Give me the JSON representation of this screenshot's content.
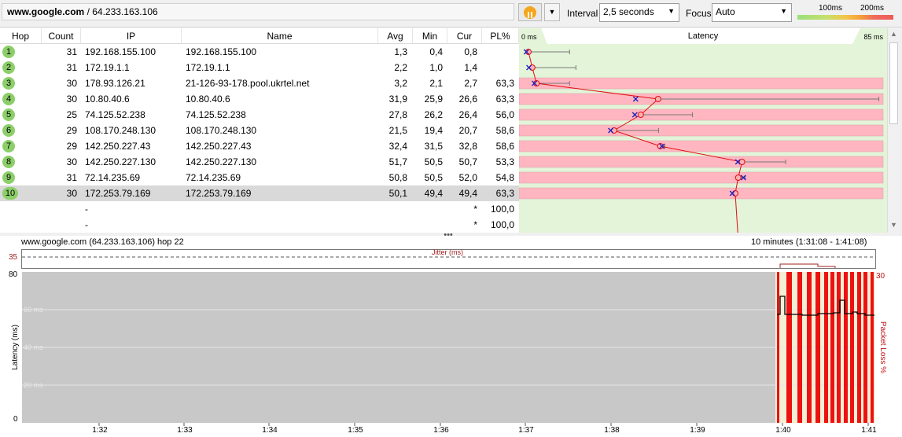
{
  "toolbar": {
    "address_host": "www.google.com",
    "address_sep": " / ",
    "address_ip": "64.233.163.106",
    "interval_label": "Interval",
    "interval_value": "2,5 seconds",
    "focus_label": "Focus",
    "focus_value": "Auto",
    "legend_100": "100ms",
    "legend_200": "200ms"
  },
  "table": {
    "headers": [
      "Hop",
      "Count",
      "IP",
      "Name",
      "Avg",
      "Min",
      "Cur",
      "PL%"
    ],
    "rows": [
      {
        "hop": "1",
        "count": "31",
        "ip": "192.168.155.100",
        "name": "192.168.155.100",
        "avg": "1,3",
        "min": "0,4",
        "cur": "0,8",
        "pl": ""
      },
      {
        "hop": "2",
        "count": "31",
        "ip": "172.19.1.1",
        "name": "172.19.1.1",
        "avg": "2,2",
        "min": "1,0",
        "cur": "1,4",
        "pl": ""
      },
      {
        "hop": "3",
        "count": "30",
        "ip": "178.93.126.21",
        "name": "21-126-93-178.pool.ukrtel.net",
        "avg": "3,2",
        "min": "2,1",
        "cur": "2,7",
        "pl": "63,3"
      },
      {
        "hop": "4",
        "count": "30",
        "ip": "10.80.40.6",
        "name": "10.80.40.6",
        "avg": "31,9",
        "min": "25,9",
        "cur": "26,6",
        "pl": "63,3"
      },
      {
        "hop": "5",
        "count": "25",
        "ip": "74.125.52.238",
        "name": "74.125.52.238",
        "avg": "27,8",
        "min": "26,2",
        "cur": "26,4",
        "pl": "56,0"
      },
      {
        "hop": "6",
        "count": "29",
        "ip": "108.170.248.130",
        "name": "108.170.248.130",
        "avg": "21,5",
        "min": "19,4",
        "cur": "20,7",
        "pl": "58,6"
      },
      {
        "hop": "7",
        "count": "29",
        "ip": "142.250.227.43",
        "name": "142.250.227.43",
        "avg": "32,4",
        "min": "31,5",
        "cur": "32,8",
        "pl": "58,6"
      },
      {
        "hop": "8",
        "count": "30",
        "ip": "142.250.227.130",
        "name": "142.250.227.130",
        "avg": "51,7",
        "min": "50,5",
        "cur": "50,7",
        "pl": "53,3"
      },
      {
        "hop": "9",
        "count": "31",
        "ip": "72.14.235.69",
        "name": "72.14.235.69",
        "avg": "50,8",
        "min": "50,5",
        "cur": "52,0",
        "pl": "54,8"
      },
      {
        "hop": "10",
        "count": "30",
        "ip": "172.253.79.169",
        "name": "172.253.79.169",
        "avg": "50,1",
        "min": "49,4",
        "cur": "49,4",
        "pl": "63,3"
      },
      {
        "hop": "",
        "count": "",
        "ip": "-",
        "name": "",
        "avg": "",
        "min": "",
        "cur": "*",
        "pl": "100,0"
      },
      {
        "hop": "",
        "count": "",
        "ip": "-",
        "name": "",
        "avg": "",
        "min": "",
        "cur": "*",
        "pl": "100,0"
      }
    ]
  },
  "latency_graph": {
    "title": "Latency",
    "min_label": "0 ms",
    "max_label": "85 ms",
    "scale_max_ms": 85,
    "points": [
      {
        "avg": 1.3,
        "cur": 0.8,
        "max": 11
      },
      {
        "avg": 2.2,
        "cur": 1.4,
        "max": 12.5
      },
      {
        "avg": 3.2,
        "cur": 2.7,
        "max": 11
      },
      {
        "avg": 31.9,
        "cur": 26.6,
        "max": 84
      },
      {
        "avg": 27.8,
        "cur": 26.4,
        "max": 40
      },
      {
        "avg": 21.5,
        "cur": 20.7,
        "max": 32
      },
      {
        "avg": 32.4,
        "cur": 32.8,
        "max": 33.5
      },
      {
        "avg": 51.7,
        "cur": 50.7,
        "max": 62
      },
      {
        "avg": 50.8,
        "cur": 52.0,
        "max": 52.5
      },
      {
        "avg": 50.1,
        "cur": 49.4,
        "max": 50.5
      }
    ],
    "loss_rows": [
      false,
      false,
      true,
      true,
      true,
      true,
      true,
      true,
      true,
      true
    ]
  },
  "history": {
    "title": "www.google.com (64.233.163.106) hop 22",
    "range": "10 minutes (1:31:08 - 1:41:08)",
    "jitter_label": "Jitter (ms)",
    "jitter_value": "35",
    "y_max": "80",
    "y_zero": "0",
    "y_label": "Latency (ms)",
    "y2_label": "Packet Loss %",
    "y2_max": "30",
    "grid_labels": [
      "60 ms",
      "40 ms",
      "20 ms"
    ],
    "x_ticks": [
      "1:32",
      "1:33",
      "1:34",
      "1:35",
      "1:36",
      "1:37",
      "1:38",
      "1:39",
      "1:40",
      "1:41"
    ]
  },
  "colors": {
    "hop_badge": "#8ccf6a",
    "latency_bg": "#e3f4d8",
    "loss_fill": "#ffb6c1",
    "line": "#e01010",
    "cross": "#2020c0",
    "bar": "#ee1111"
  }
}
